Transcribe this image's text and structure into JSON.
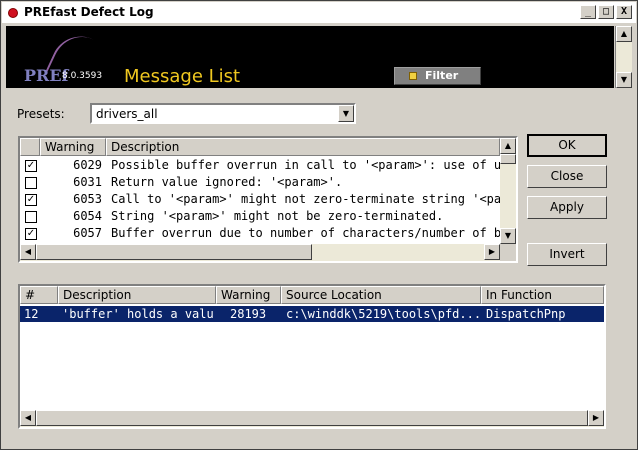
{
  "window": {
    "title": "PREfast Defect Log",
    "btn_min": "_",
    "btn_max": "□",
    "btn_close": "X"
  },
  "banner": {
    "logo_text": "PREf",
    "version": "8.0.3593",
    "title": "Message List",
    "filter_label": "Filter"
  },
  "presets": {
    "label": "Presets:",
    "value": "drivers_all"
  },
  "warnings_list": {
    "columns": [
      "Warning",
      "Description"
    ],
    "rows": [
      {
        "checked": true,
        "check_mark": "✓",
        "warning": "6029",
        "description": "Possible buffer overrun in call to '<param>': use of uncheck"
      },
      {
        "checked": false,
        "check_mark": "",
        "warning": "6031",
        "description": "Return value ignored: '<param>'."
      },
      {
        "checked": true,
        "check_mark": "✓",
        "warning": "6053",
        "description": "Call to '<param>' might not zero-terminate string '<param>"
      },
      {
        "checked": false,
        "check_mark": "",
        "warning": "6054",
        "description": "String '<param>' might not be zero-terminated."
      },
      {
        "checked": true,
        "check_mark": "✓",
        "warning": "6057",
        "description": "Buffer overrun due to number of characters/number of byte"
      }
    ]
  },
  "buttons": {
    "ok": "OK",
    "close": "Close",
    "apply": "Apply",
    "invert": "Invert"
  },
  "defects_list": {
    "columns": [
      "#",
      "Description",
      "Warning",
      "Source Location",
      "In Function"
    ],
    "rows": [
      {
        "num": "12",
        "description": "'buffer' holds a valu...",
        "warning": "28193",
        "source": "c:\\winddk\\5219\\tools\\pfd...",
        "function": "DispatchPnp",
        "selected": true
      }
    ]
  },
  "colors": {
    "selection": "#0a246a",
    "banner_title": "#f0c820",
    "banner_bg": "#000000",
    "face": "#d4d0c8"
  }
}
